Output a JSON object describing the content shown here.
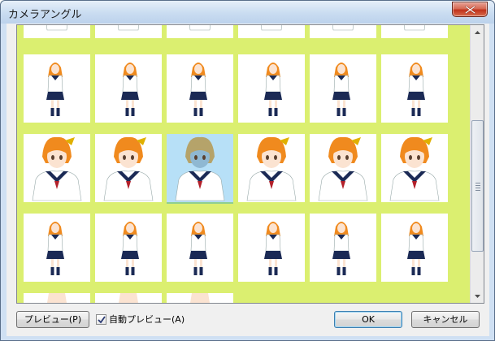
{
  "window": {
    "title": "カメラアングル"
  },
  "gallery": {
    "row_partial_top": {
      "count": 6
    },
    "rows": [
      {
        "name": "standing-views",
        "count": 6
      },
      {
        "name": "face-closeups",
        "count": 6,
        "selected_index": 2
      },
      {
        "name": "walking-views",
        "count": 6
      },
      {
        "name": "partial-bottom",
        "count": 3
      }
    ],
    "accent_background": "#dbef70",
    "selection_color": "#b7e0f7"
  },
  "buttons": {
    "preview_label": "プレビュー(P)",
    "ok_label": "OK",
    "cancel_label": "キャンセル"
  },
  "auto_preview": {
    "label": "自動プレビュー(A)",
    "checked": true
  },
  "icons": {
    "close": "close-icon",
    "scroll_up": "scroll-up-arrow-icon",
    "scroll_down": "scroll-down-arrow-icon",
    "check": "check-mark-icon"
  }
}
